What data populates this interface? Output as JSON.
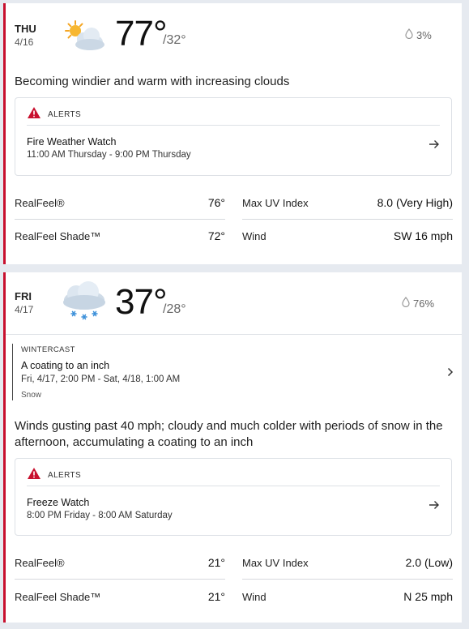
{
  "colors": {
    "accent": "#c8102e",
    "divider": "#dde1e6"
  },
  "days": [
    {
      "dow": "THU",
      "date": "4/16",
      "icon": "partly-cloudy-sun-icon",
      "temp": "77°",
      "low": "/32°",
      "precip": "3%",
      "phrase": "Becoming windier and warm with increasing clouds",
      "alert": {
        "label": "ALERTS",
        "title": "Fire Weather Watch",
        "time": "11:00 AM Thursday - 9:00 PM Thursday"
      },
      "details": {
        "realfeel_label": "RealFeel®",
        "realfeel": "76°",
        "shade_label": "RealFeel Shade™",
        "shade": "72°",
        "uv_label": "Max UV Index",
        "uv": "8.0 (Very High)",
        "wind_label": "Wind",
        "wind": "SW 16 mph"
      }
    },
    {
      "dow": "FRI",
      "date": "4/17",
      "icon": "snow-cloud-icon",
      "temp": "37°",
      "low": "/28°",
      "precip": "76%",
      "wintercast": {
        "label": "WINTERCAST",
        "title": "A coating to an inch",
        "time": "Fri, 4/17, 2:00 PM - Sat, 4/18, 1:00 AM",
        "type": "Snow"
      },
      "phrase": "Winds gusting past 40 mph; cloudy and much colder with periods of snow in the afternoon, accumulating a coating to an inch",
      "alert": {
        "label": "ALERTS",
        "title": "Freeze Watch",
        "time": "8:00 PM Friday - 8:00 AM Saturday"
      },
      "details": {
        "realfeel_label": "RealFeel®",
        "realfeel": "21°",
        "shade_label": "RealFeel Shade™",
        "shade": "21°",
        "uv_label": "Max UV Index",
        "uv": "2.0 (Low)",
        "wind_label": "Wind",
        "wind": "N 25 mph"
      }
    }
  ]
}
